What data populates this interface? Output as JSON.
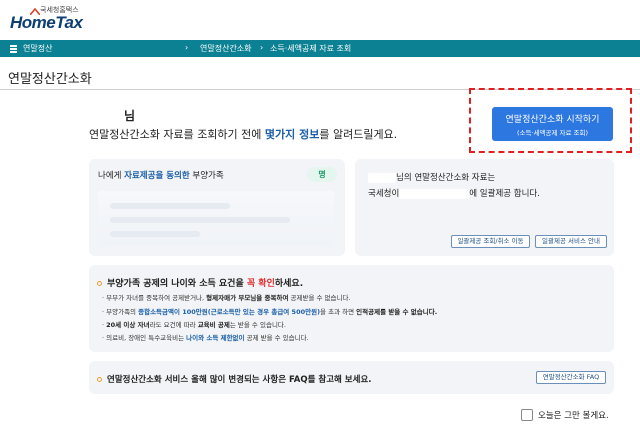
{
  "header": {
    "logo_sub": "국세청홈택스",
    "logo_main": "HomeTax"
  },
  "navbar": {
    "menu_label": "연말정산",
    "crumbs": [
      "연말정산간소화",
      "소득·세액공제 자료 조회"
    ]
  },
  "page": {
    "title": "연말정산간소화",
    "user_suffix": "님",
    "intro_prefix": "연말정산간소화 자료를 조회하기 전에 ",
    "intro_highlight": "몇가지 정보",
    "intro_suffix": "를 알려드릴게요."
  },
  "start_button": {
    "label": "연말정산간소화 시작하기",
    "sublabel": "(소득·세액공제 자료 조회)"
  },
  "dependents_card": {
    "prefix": "나에게 ",
    "highlight": "자료제공을 동의한",
    "suffix": " 부양가족",
    "count": "명"
  },
  "provision_card": {
    "line1": "님의 연말정산간소화 자료는",
    "line2_prefix": "국세청이",
    "line2_suffix": "에 일괄제공 합니다.",
    "button1": "일괄제공 조회/취소 이동",
    "button2": "일괄제공 서비스 안내"
  },
  "requirements": {
    "title_prefix": "부양가족 공제의 나이와 소득 요건을 ",
    "title_highlight": "꼭 확인",
    "title_suffix": "하세요.",
    "item1_a": "· 부부가 자녀를 중복하여 공제받거나, ",
    "item1_b": "형제자매가 부모님을 중복하여",
    "item1_c": " 공제받을 수 없습니다.",
    "item2_a": "· 부양가족의 ",
    "item2_b": "종합소득금액이 100만원(근로소득만 있는 경우 총급여 500만원)",
    "item2_c": "을 초과 하면 ",
    "item2_d": "인적공제를 받을 수 없습니다.",
    "item3_a": "· ",
    "item3_b": "20세 이상 자녀",
    "item3_c": "라도 요건에 따라 ",
    "item3_d": "교육비 공제",
    "item3_e": "는 받을 수 있습니다.",
    "item4_a": "· 의료비, 장애인 특수교육비는 ",
    "item4_b": "나이와 소득 제한없이",
    "item4_c": " 공제 받을 수 있습니다."
  },
  "faq": {
    "text": "연말정산간소화 서비스 올해 많이 변경되는 사항은 FAQ를 참고해 보세요.",
    "button": "연말정산간소화 FAQ"
  },
  "dismiss": {
    "label": "오늘은 그만 볼게요."
  },
  "colors": {
    "navbar": "#0b8193",
    "primary_button": "#2c77e0",
    "highlight_text": "#1a5fa8",
    "alert_red": "#e02020"
  }
}
